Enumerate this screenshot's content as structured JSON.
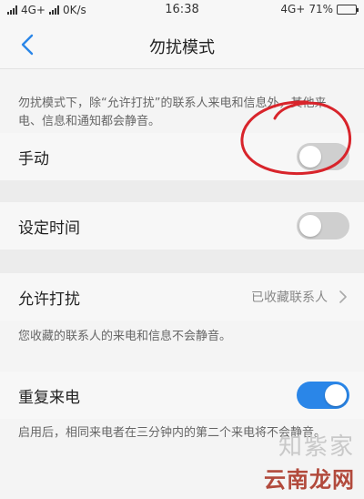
{
  "status_bar": {
    "left_text": "4G+",
    "speed": "0K/s",
    "time": "16:38",
    "right_network": "4G+",
    "battery_percent": "71%",
    "battery_level": 0.71
  },
  "nav": {
    "title": "勿扰模式"
  },
  "intro_text": "勿扰模式下，除“允许打扰”的联系人来电和信息外，其他来电、信息和通知都会静音。",
  "settings": {
    "manual": {
      "label": "手动",
      "enabled": false
    },
    "schedule": {
      "label": "设定时间",
      "enabled": false
    },
    "allow": {
      "label": "允许打扰",
      "value": "已收藏联系人"
    },
    "allow_desc": "您收藏的联系人的来电和信息不会静音。",
    "repeat": {
      "label": "重复来电",
      "enabled": true
    },
    "repeat_desc": "启用后，相同来电者在三分钟内的第二个来电将不会静音。"
  },
  "watermark": {
    "top": "知紫家",
    "bottom": "云南龙网"
  }
}
